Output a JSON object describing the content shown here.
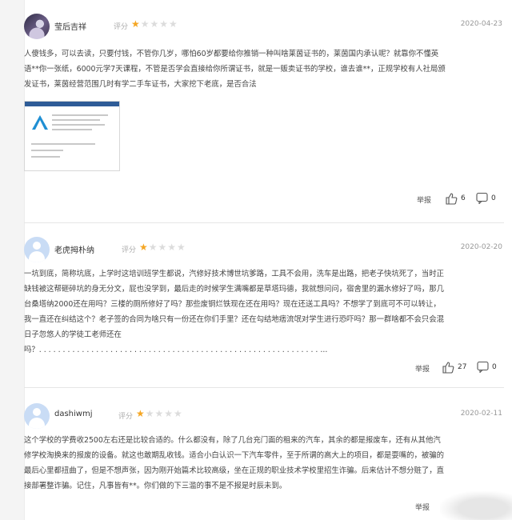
{
  "rating_label": "评分",
  "reviews": [
    {
      "user": "莹后吉祥",
      "date": "2020-04-23",
      "rating": 1,
      "text_lines": [
        "人傻钱多，可以去读，只要付钱，不管你几岁，哪怕60岁都要给你推销一种叫啥莱茵证书的，莱茵国内承认呢？就靠你不懂英",
        "语**你一张纸，6000元学7天课程，不管是否学会直接给你所谓证书，就是一贩卖证书的学校，谁去谁**，正规学校有人社局颁",
        "发证书，莱茵经营范围几时有学二手车证书，大家挖下老底，是否合法"
      ],
      "report": "举报",
      "likes": "6",
      "comments": "0"
    },
    {
      "user": "老虎拇朴纳",
      "date": "2020-02-20",
      "rating": 1,
      "text_lines": [
        "一坑到底，简称坑底，上学时这培训班学生都说，汽修好技术博世坑爹路，工具不会用，洗车是出路，把老子快坑死了，当时正",
        "缺钱被这帮砸碎坑的身无分文，屁也没学到，最后走的时候学生满嘴都是草塔玛德，我就想问问，宿舍里的漏水修好了吗，那几",
        "台桑塔纳2000还在用吗？三楼的厕所修好了吗？那些废铜烂铁现在还在用吗？现在还送工具吗？不想学了到底可不可以转让，",
        "我一直还在纠结这个？老子签的合同为啥只有一份还在你们手里？还在勾结地痞流氓对学生进行恐吓吗？那一群啥都不会只会混",
        "日子忽悠人的学徒工老师还在",
        "吗？. . . . . . . . . . . . . . . . . . . . . . . . . . . . . . . . . . . . . . . . . . . . . . . . . . . . . . . . . . . ..."
      ],
      "report": "举报",
      "likes": "27",
      "comments": "0"
    },
    {
      "user": "dashiwmj",
      "date": "2020-02-11",
      "rating": 1,
      "text_lines": [
        "这个学校的学费收2500左右还是比较合适的。什么都没有，除了几台充门面的租来的汽车，其余的都是报废车，还有从其他汽",
        "修学校淘换来的报废的设备。就这也敢期乱收钱。适合小白认识一下汽车零件，至于所谓的高大上的项目，都是耍嘴的，被骗的",
        "最后心里都扭曲了，但是不想声张，因为刚开始篇术比较高级，坐在正规的职业技术学校里招生诈骗。后来估计不想分赃了，直",
        "接部署整诈骗。记住，凡事皆有**。你们做的下三滥的事不是不报是时辰未到。"
      ],
      "report": "举报",
      "likes": "",
      "comments": ""
    }
  ]
}
